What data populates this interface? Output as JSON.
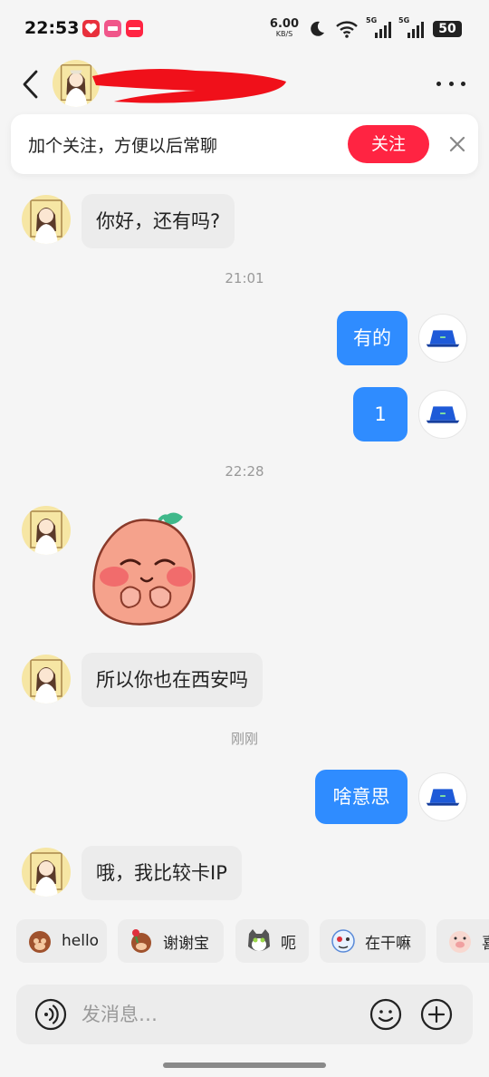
{
  "status_bar": {
    "time": "22:53",
    "net_speed": "6.00",
    "net_unit": "KB/S",
    "sim1_label": "5G",
    "sim2_label": "5G",
    "battery": "50",
    "app_badges": [
      "red-heart-app",
      "pink-video-app",
      "red-book-app"
    ]
  },
  "header": {
    "contact_name": "",
    "back_icon": "chevron-left-icon",
    "more_icon": "more-dots-icon"
  },
  "follow_banner": {
    "text": "加个关注，方便以后常聊",
    "button_label": "关注",
    "accent_color": "#ff2442"
  },
  "messages": [
    {
      "from": "them",
      "text": "你好，还有吗?"
    },
    {
      "type": "time",
      "text": "21:01"
    },
    {
      "from": "me",
      "text": "有的"
    },
    {
      "from": "me",
      "text": "1"
    },
    {
      "type": "time",
      "text": "22:28"
    },
    {
      "from": "them",
      "type": "sticker",
      "sticker": "blushing-peach-sticker"
    },
    {
      "from": "them",
      "text": "所以你也在西安吗"
    },
    {
      "type": "time",
      "text": "刚刚"
    },
    {
      "from": "me",
      "text": "啥意思"
    },
    {
      "from": "them",
      "text": "哦，我比较卡IP"
    }
  ],
  "quick_replies": [
    {
      "label": "hello",
      "icon": "monkey-wave-icon"
    },
    {
      "label": "谢谢宝",
      "icon": "monkey-rose-icon"
    },
    {
      "label": "呃",
      "icon": "cat-face-icon"
    },
    {
      "label": "在干嘛",
      "icon": "bubble-character-icon"
    },
    {
      "label": "喜",
      "icon": "pig-face-icon"
    }
  ],
  "input": {
    "placeholder": "发消息…"
  },
  "colors": {
    "outgoing_bubble": "#2f8cff",
    "incoming_bubble": "#ececec",
    "follow_button": "#ff2442"
  }
}
